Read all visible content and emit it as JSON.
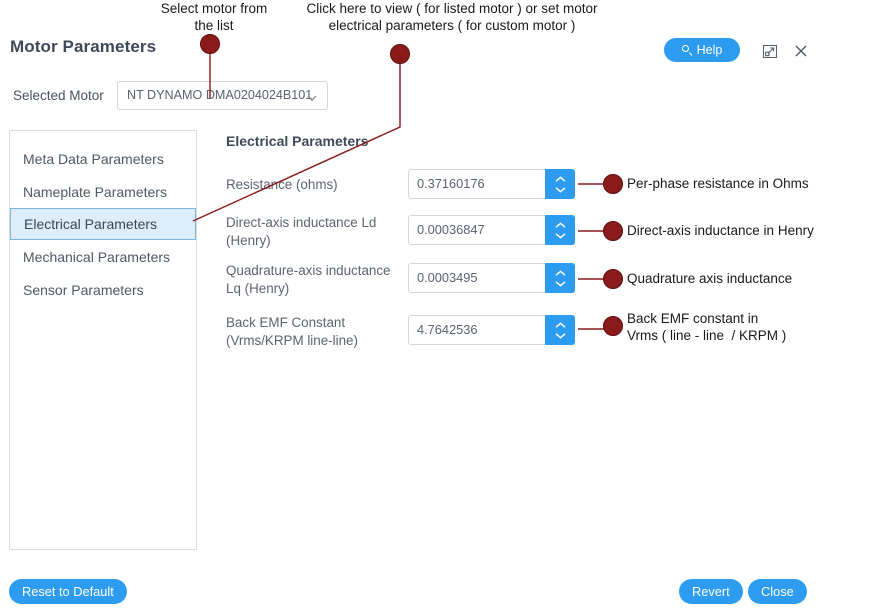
{
  "header": {
    "title": "Motor Parameters",
    "help_label": "Help",
    "help_icon": "search-icon",
    "popout_icon": "popout-icon",
    "close_icon": "close-icon"
  },
  "selected_motor": {
    "label": "Selected Motor",
    "value": "NT DYNAMO DMA0204024B101",
    "chevron_icon": "chevron-down-icon"
  },
  "sidebar": {
    "items": [
      {
        "label": "Meta Data Parameters",
        "selected": false
      },
      {
        "label": "Nameplate Parameters",
        "selected": false
      },
      {
        "label": "Electrical Parameters",
        "selected": true
      },
      {
        "label": "Mechanical Parameters",
        "selected": false
      },
      {
        "label": "Sensor Parameters",
        "selected": false
      }
    ]
  },
  "form": {
    "heading": "Electrical Parameters",
    "fields": [
      {
        "label": "Resistance (ohms)",
        "value": "0.37160176"
      },
      {
        "label": "Direct-axis inductance Ld (Henry)",
        "value": "0.00036847"
      },
      {
        "label": "Quadrature-axis inductance Lq (Henry)",
        "value": "0.0003495"
      },
      {
        "label": "Back EMF Constant (Vrms/KRPM line-line)",
        "value": "4.7642536"
      }
    ]
  },
  "footer": {
    "reset_label": "Reset to Default",
    "revert_label": "Revert",
    "close_label": "Close"
  },
  "annotations": {
    "top": [
      "Select motor from\nthe list",
      "Click here to view ( for listed motor ) or set motor\nelectrical parameters ( for custom motor )"
    ],
    "right": [
      "Per-phase resistance in Ohms",
      "Direct-axis inductance in Henry",
      "Quadrature axis inductance",
      "Back EMF constant in\nVrms ( line - line  / KRPM )"
    ]
  },
  "colors": {
    "accent_blue": "#2d9cf0",
    "annotation_red": "#8b1a1a",
    "selected_row_bg": "#ddeefb",
    "selected_row_border": "#7bb6e0"
  }
}
